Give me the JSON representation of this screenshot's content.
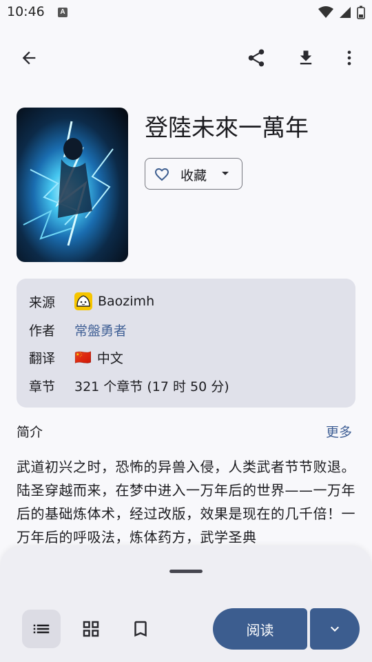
{
  "status": {
    "time": "10:46",
    "a_badge": "A"
  },
  "toolbar": {
    "icons": [
      "arrow-back-icon",
      "share-icon",
      "download-icon",
      "more-vert-icon"
    ]
  },
  "manga": {
    "title": "登陸未來一萬年",
    "favorite_label": "收藏"
  },
  "info": {
    "source_key": "来源",
    "source_value": "Baozimh",
    "author_key": "作者",
    "author_value": "常盤勇者",
    "translation_key": "翻译",
    "translation_flag": "🇨🇳",
    "translation_value": "中文",
    "chapters_key": "章节",
    "chapters_value": "321 个章节 (17 时 50 分)"
  },
  "intro": {
    "title": "简介",
    "more_label": "更多",
    "text": "武道初兴之时，恐怖的异兽入侵，人类武者节节败退。陆圣穿越而来，在梦中进入一万年后的世界——一万年后的基础炼体术，经过改版，效果是现在的几千倍！一万年后的呼吸法，炼体药方，武学圣典"
  },
  "bottom": {
    "read_label": "阅读"
  },
  "colors": {
    "accent": "#3c5d8f",
    "link": "#3f5f95",
    "info_bg": "#e0e1ea",
    "sheet_bg": "#eeeef3"
  }
}
